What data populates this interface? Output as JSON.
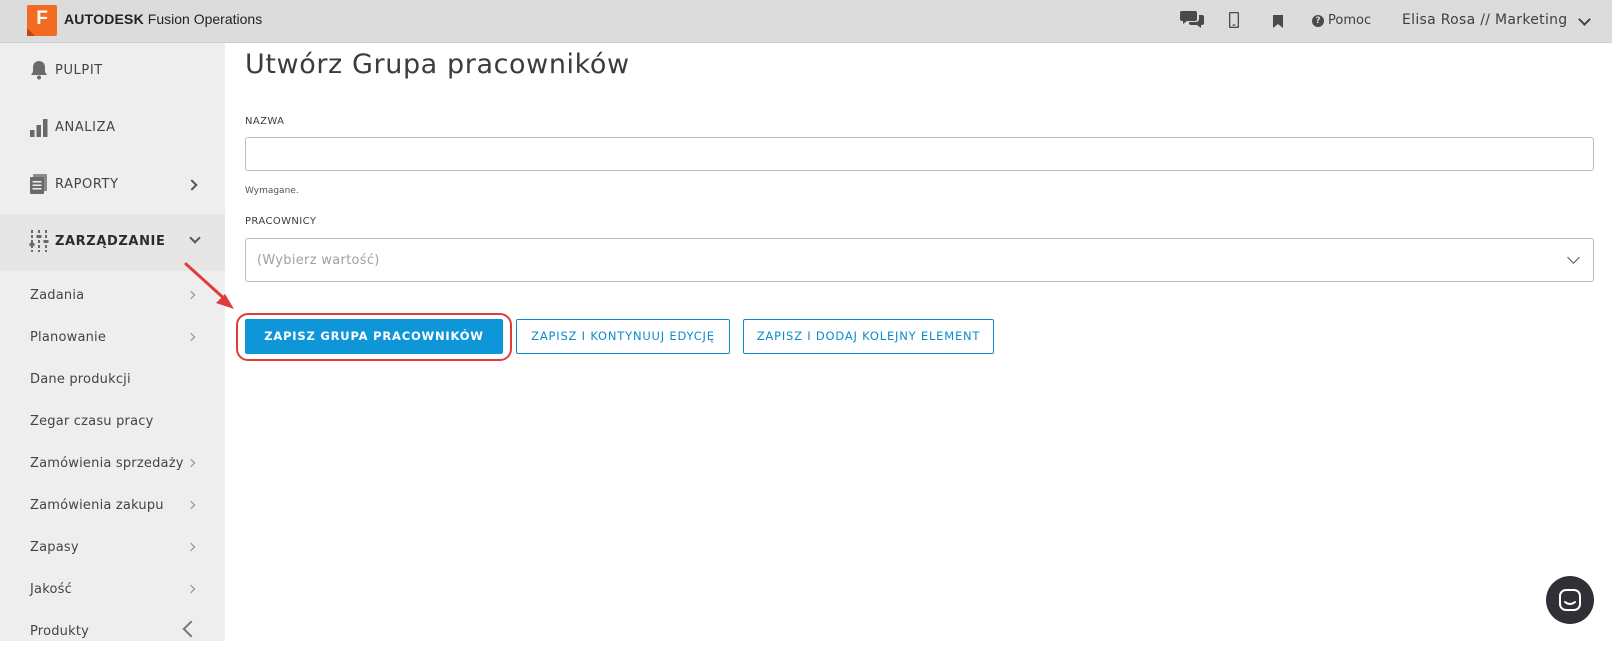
{
  "app": {
    "logo_letter": "F",
    "brand_bold": "AUTODESK",
    "brand_rest": "Fusion Operations"
  },
  "topbar": {
    "icons": [
      "chat-bubbles-icon",
      "mobile-phone-icon",
      "bookmark-icon"
    ],
    "help_label": "Pomoc",
    "user_label": "Elisa Rosa // Marketing"
  },
  "sidebar": {
    "main_items": [
      {
        "label": "PULPIT",
        "icon": "bell-icon"
      },
      {
        "label": "ANALIZA",
        "icon": "bar-chart-icon"
      },
      {
        "label": "RAPORTY",
        "icon": "reports-icon"
      },
      {
        "label": "ZARZĄDZANIE",
        "icon": "sliders-icon",
        "expanded": true
      }
    ],
    "sub_items": [
      {
        "label": "Zadania"
      },
      {
        "label": "Planowanie"
      },
      {
        "label": "Dane produkcji"
      },
      {
        "label": "Zegar czasu pracy"
      },
      {
        "label": "Zamówienia sprzedaży"
      },
      {
        "label": "Zamówienia zakupu"
      },
      {
        "label": "Zapasy"
      },
      {
        "label": "Jakość"
      },
      {
        "label": "Produkty"
      }
    ]
  },
  "form": {
    "title": "Utwórz Grupa pracowników",
    "name_label": "NAZWA",
    "name_value": "",
    "name_hint": "Wymagane.",
    "employees_label": "PRACOWNICY",
    "employees_placeholder": "(Wybierz wartość)"
  },
  "buttons": {
    "save": "ZAPISZ GRUPA PRACOWNIKÓW",
    "save_continue": "ZAPISZ I KONTYNUUJ EDYCJĘ",
    "save_add": "ZAPISZ I DODAJ KOLEJNY ELEMENT"
  },
  "colors": {
    "accent": "#0f96d8",
    "annotation": "#e03c3c",
    "brand_orange": "#f26b21"
  }
}
